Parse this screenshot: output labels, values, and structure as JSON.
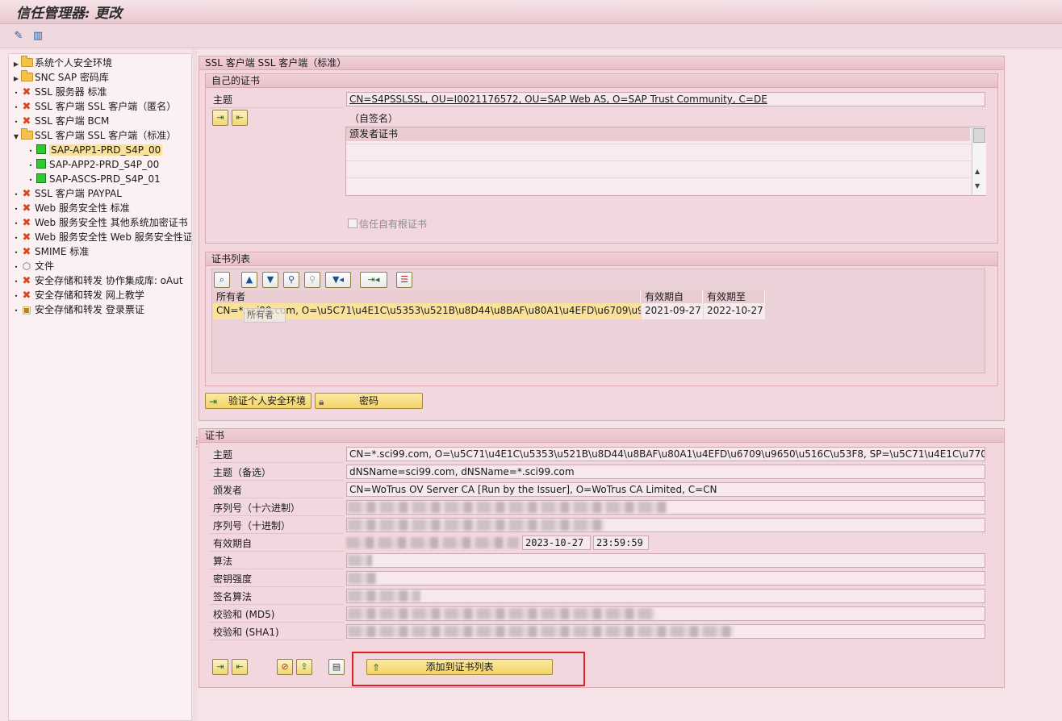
{
  "window": {
    "title": "信任管理器: 更改"
  },
  "toolbar": {
    "icons": [
      "glasses-edit-icon",
      "info-book-icon"
    ]
  },
  "tree": {
    "items": [
      {
        "label": "系统个人安全环境",
        "icon": "folder-icon",
        "expander": "▶"
      },
      {
        "label": "SNC SAP 密码库",
        "icon": "folder-icon",
        "expander": "▶"
      },
      {
        "label": "SSL 服务器 标准",
        "icon": "red-x-icon",
        "expander": "•"
      },
      {
        "label": "SSL 客户端 SSL 客户端（匿名）",
        "icon": "red-x-icon",
        "expander": "•"
      },
      {
        "label": "SSL 客户端 BCM",
        "icon": "red-x-icon",
        "expander": "•"
      },
      {
        "label": "SSL 客户端 SSL 客户端（标准）",
        "icon": "folder-open-icon",
        "expander": "▼"
      },
      {
        "label": "SAP-APP1-PRD_S4P_00",
        "icon": "green-square-icon",
        "expander": "•",
        "selected": true
      },
      {
        "label": "SAP-APP2-PRD_S4P_00",
        "icon": "green-square-icon",
        "expander": "•"
      },
      {
        "label": "SAP-ASCS-PRD_S4P_01",
        "icon": "green-square-icon",
        "expander": "•"
      },
      {
        "label": "SSL 客户端 PAYPAL",
        "icon": "red-x-icon",
        "expander": "•"
      },
      {
        "label": "Web 服务安全性 标准",
        "icon": "red-x-icon",
        "expander": "•"
      },
      {
        "label": "Web 服务安全性 其他系统加密证书",
        "icon": "red-x-icon",
        "expander": "•"
      },
      {
        "label": "Web 服务安全性 Web 服务安全性证",
        "icon": "red-x-icon",
        "expander": "•"
      },
      {
        "label": "SMIME 标准",
        "icon": "red-x-icon",
        "expander": "•"
      },
      {
        "label": "文件",
        "icon": "cube-icon",
        "expander": "•"
      },
      {
        "label": "安全存储和转发 协作集成库: oAut",
        "icon": "red-x-icon",
        "expander": "•"
      },
      {
        "label": "安全存储和转发 网上教学",
        "icon": "red-x-icon",
        "expander": "•"
      },
      {
        "label": "安全存储和转发 登录票证",
        "icon": "lock-doc-icon",
        "expander": "•"
      }
    ]
  },
  "pse": {
    "title": "SSL 客户端 SSL 客户端（标准）",
    "own_cert": {
      "title": "自己的证书",
      "subject_label": "主题",
      "subject_value": "CN=S4PSSLSSL, OU=I0021176572, OU=SAP Web AS, O=SAP Trust Community, C=DE",
      "self_signed": "（自签名）",
      "issuer_col": "颁发者证书",
      "trust_root": "信任自有根证书"
    },
    "cert_list": {
      "title": "证书列表",
      "cols": [
        "所有者",
        "有效期自",
        "有效期至"
      ],
      "rows": [
        {
          "owner": "CN=*.sci99.com, O=\\u5C71\\u4E1C\\u5353\\u521B\\u8D44\\u8BAF\\u80A1\\u4EFD\\u6709\\u9650...",
          "from": "2021-09-27",
          "to": "2022-10-27"
        }
      ],
      "tooltip": "所有者"
    },
    "verify_btn": "验证个人安全环境",
    "password_btn": "密码"
  },
  "cert": {
    "title": "证书",
    "labels": [
      "主题",
      "主题（备选）",
      "颁发者",
      "序列号（十六进制）",
      "序列号（十进制）",
      "有效期自",
      "算法",
      "密钥强度",
      "签名算法",
      "校验和 (MD5)",
      "校验和 (SHA1)"
    ],
    "subject": "CN=*.sci99.com, O=\\u5C71\\u4E1C\\u5353\\u521B\\u8D44\\u8BAF\\u80A1\\u4EFD\\u6709\\u9650\\u516C\\u53F8, SP=\\u5C71\\u4E1C\\u7701, C=C...",
    "alt_subject": "dNSName=sci99.com, dNSName=*.sci99.com",
    "issuer": "CN=WoTrus OV Server CA  [Run by the Issuer], O=WoTrus CA Limited, C=CN",
    "valid_to_date": "2023-10-27",
    "valid_to_time": "23:59:59",
    "add_btn": "添加到证书列表"
  },
  "colors": {
    "highlight_box": "#e02020",
    "selected_row": "#fbe29a"
  }
}
